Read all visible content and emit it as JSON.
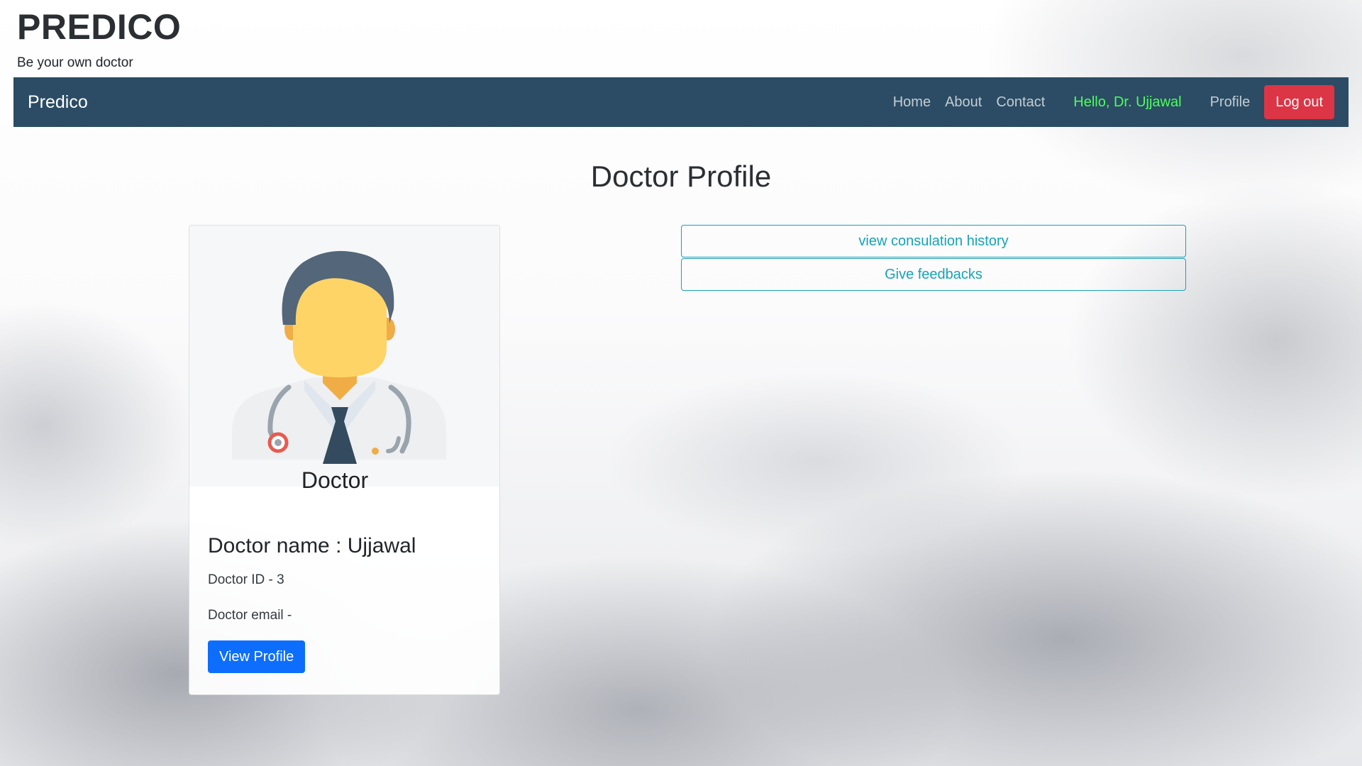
{
  "header": {
    "title": "PREDICO",
    "tagline": "Be your own doctor"
  },
  "navbar": {
    "brand": "Predico",
    "links": [
      "Home",
      "About",
      "Contact"
    ],
    "greeting": "Hello, Dr. Ujjawal",
    "profile": "Profile",
    "logout": "Log out",
    "greeting_color": "#4cff5a",
    "background_color": "#2b4c64"
  },
  "main": {
    "title": "Doctor Profile"
  },
  "card": {
    "image_icon": "doctor-avatar-icon",
    "image_caption": "Doctor",
    "name": "Doctor name : Ujjawal",
    "id_text": "Doctor ID - 3",
    "email_text": "Doctor email -",
    "button": "View Profile"
  },
  "actions": {
    "history": "view consulation history",
    "feedback": "Give feedbacks",
    "accent_color": "#17a2b8"
  }
}
